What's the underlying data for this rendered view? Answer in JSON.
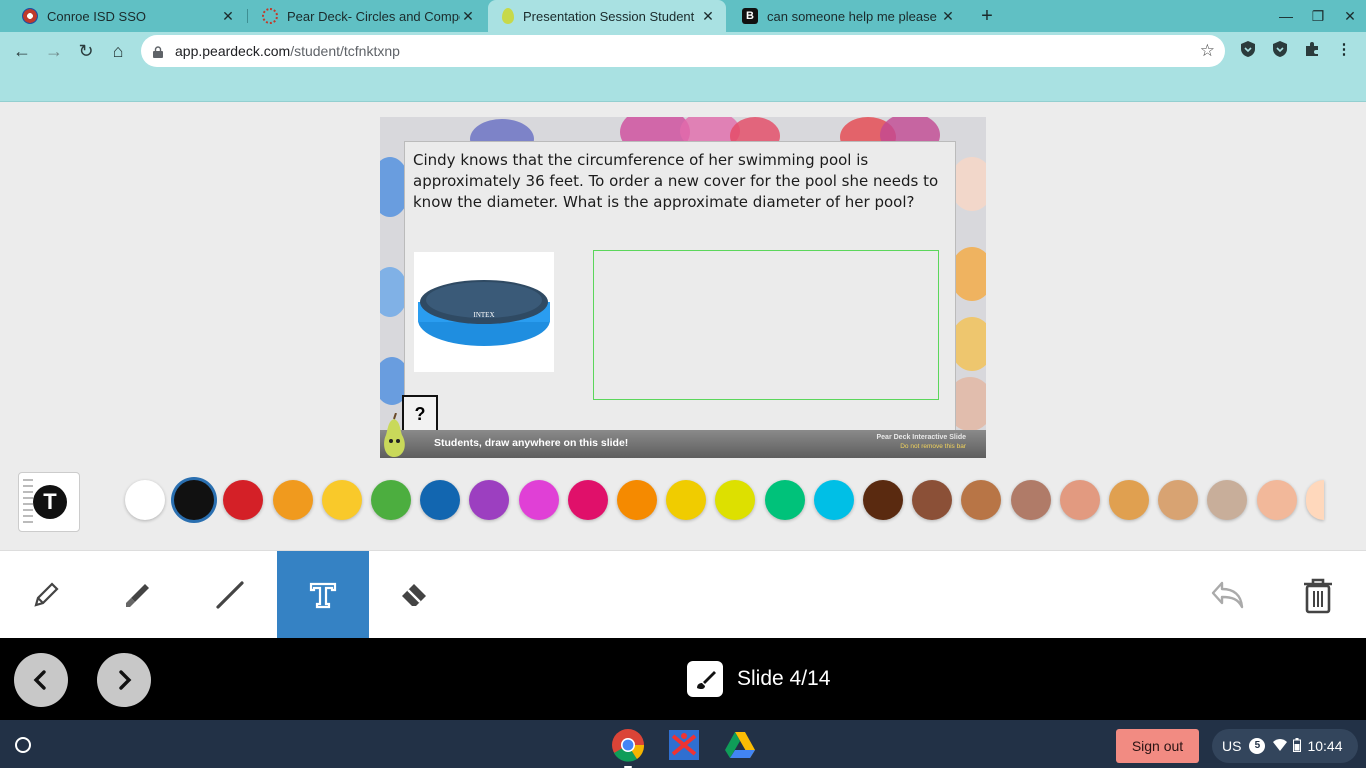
{
  "browser": {
    "tabs": [
      {
        "title": "Conroe ISD SSO",
        "close": "✕"
      },
      {
        "title": "Pear Deck- Circles and Composit",
        "close": "✕"
      },
      {
        "title": "Presentation Session Student",
        "close": "✕"
      },
      {
        "title": "can someone help me please - Br",
        "close": "✕"
      }
    ],
    "new_tab": "+",
    "url_host": "app.peardeck.com",
    "url_path": "/student/tcfnktxnp"
  },
  "slide": {
    "question": "Cindy knows that the circumference of her swimming pool is approximately 36 feet. To order a new cover for the pool she needs to know the diameter.  What is the approximate diameter of her pool?",
    "pool_brand": "INTEX",
    "question_mark": "?",
    "footer_message": "Students, draw anywhere on this slide!",
    "footer_right_1": "Pear Deck Interactive Slide",
    "footer_right_2": "Do not remove this bar"
  },
  "palette": {
    "selected": "#111111",
    "colors": [
      "#ffffff",
      "#111111",
      "#d42027",
      "#f09a1e",
      "#f9c92a",
      "#4cae3f",
      "#1266b0",
      "#9c3fc0",
      "#e040d6",
      "#e0106a",
      "#f58a00",
      "#f0cc00",
      "#dde000",
      "#00c27a",
      "#00bfe6",
      "#5a2a10",
      "#8b5037",
      "#b87546",
      "#b07b68",
      "#e29a80",
      "#e0a050",
      "#d8a372",
      "#c8ae9a",
      "#f2b89a",
      "#ffd8bc"
    ]
  },
  "tools": {
    "active": "text",
    "items": [
      "pencil",
      "marker",
      "line",
      "text",
      "eraser"
    ]
  },
  "nav": {
    "slide_label": "Slide 4/14"
  },
  "shelf": {
    "sign_out": "Sign out",
    "ime": "US",
    "notifications": "5",
    "time": "10:44"
  }
}
